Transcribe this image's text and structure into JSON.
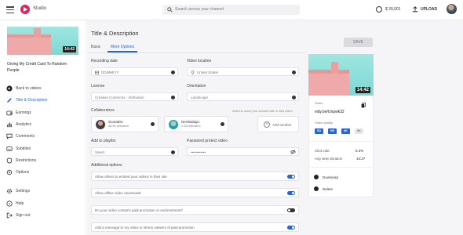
{
  "topbar": {
    "brand": "Studio",
    "search_placeholder": "Search across your channel",
    "balance": "$ 39,001",
    "upload_label": "UPLOAD"
  },
  "sidebar": {
    "thumb_duration": "14:42",
    "video_title": "Giving My Credit Card To Random People",
    "items": [
      {
        "label": "Back to videos",
        "icon": "arrow-left-icon"
      },
      {
        "label": "Title & Description",
        "icon": "pencil-icon"
      },
      {
        "label": "Earnings",
        "icon": "wallet-icon"
      },
      {
        "label": "Analytics",
        "icon": "bar-chart-icon"
      },
      {
        "label": "Comments",
        "icon": "comment-icon"
      },
      {
        "label": "Subtitles",
        "icon": "subtitles-icon"
      },
      {
        "label": "Restrictions",
        "icon": "shield-icon"
      },
      {
        "label": "Options",
        "icon": "options-icon"
      },
      {
        "label": "Settings",
        "icon": "gear-icon"
      },
      {
        "label": "Help",
        "icon": "help-icon"
      },
      {
        "label": "Sign out",
        "icon": "signout-icon"
      }
    ]
  },
  "page": {
    "title": "Title & Description",
    "tabs": [
      "Basic",
      "More Options"
    ],
    "save_label": "SAVE"
  },
  "form": {
    "recording_date": {
      "label": "Recording date",
      "placeholder": "DD/MM/YY"
    },
    "video_location": {
      "label": "Video location",
      "placeholder": "United States"
    },
    "license": {
      "label": "License",
      "value": "Creative Commons - Attribution"
    },
    "orientation": {
      "label": "Orientation",
      "value": "Landscape"
    },
    "collaborators": {
      "label": "Collaborators",
      "hint": "Add the users you worked with in this video",
      "people": [
        {
          "name": "ScaraBro",
          "followers": "46.3K followers"
        },
        {
          "name": "Nerdsdaigo",
          "followers": "1.1M followers"
        }
      ],
      "add_label": "Add another"
    },
    "playlist": {
      "label": "Add to playlist",
      "value": "Select"
    },
    "password": {
      "label": "Password protect video",
      "value": "••••••••••••"
    },
    "additional_label": "Additional options",
    "options": [
      {
        "text": "Allow others to embed your videos in their site",
        "on": true
      },
      {
        "text": "Allow offline video downloads",
        "on": true
      },
      {
        "text": "Do your video contains paid promotion or endorsement?",
        "on": false
      },
      {
        "text": "Add a message to my video to inform viewers of paid promotion",
        "on": true
      }
    ]
  },
  "right_panel": {
    "duration": "14:42",
    "share_label": "Share",
    "share_link": "vidy.be/Unpwk32",
    "quality_label": "Video quality",
    "qualities": [
      "SD",
      "HD",
      "4K",
      "8K"
    ],
    "click_rate_label": "Click rate",
    "click_rate": "5.4%",
    "avg_duration_label": "Avg view duration",
    "avg_duration": "14:27",
    "download_label": "Download",
    "delete_label": "Delete"
  },
  "colors": {
    "accent": "#2a63d8",
    "toggle_on": "#2a63d8",
    "toggle_off": "#333333",
    "thumb_sky": "#8fe0db",
    "thumb_building": "#efa9a9"
  }
}
